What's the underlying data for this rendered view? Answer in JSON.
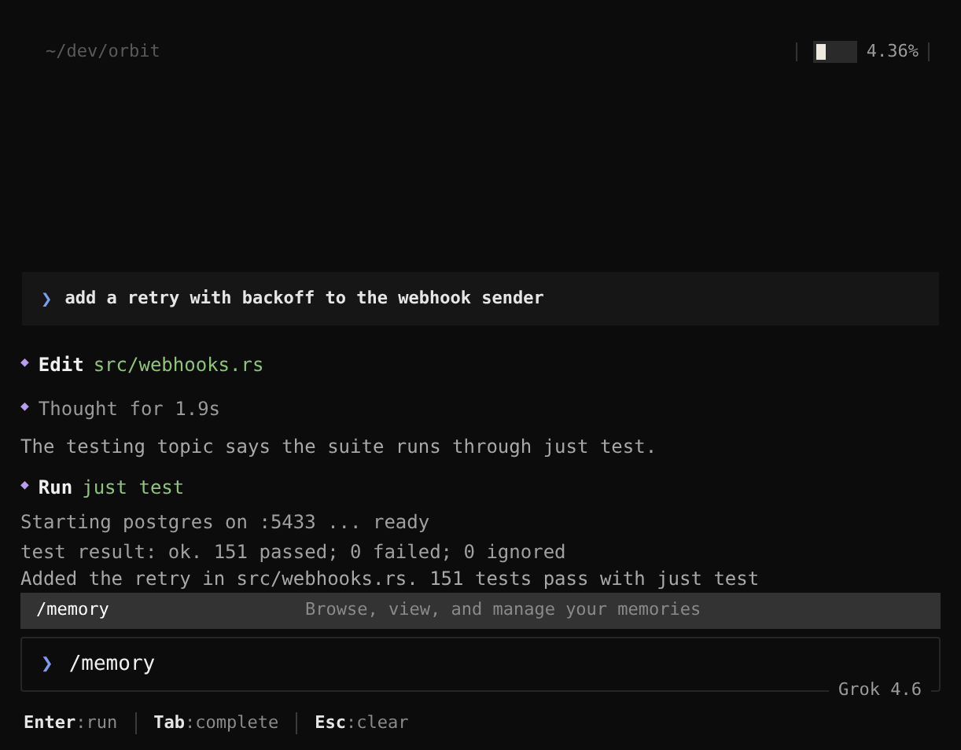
{
  "header": {
    "path": "~/dev/orbit",
    "context": {
      "level": 0.25,
      "reading": "4.36%"
    }
  },
  "prompt": {
    "glyph": "❯",
    "text": "add a retry with backoff to the webhook sender"
  },
  "transcript": [
    {
      "kind": "action",
      "marker": "◆",
      "verb": "Edit",
      "target": "src/webhooks.rs"
    },
    {
      "kind": "thought",
      "marker": "◆",
      "text": "Thought for 1.9s"
    },
    {
      "kind": "text",
      "text": "The testing topic says the suite runs through just test."
    },
    {
      "kind": "action",
      "marker": "◆",
      "verb": "Run",
      "target": "just test"
    },
    {
      "kind": "output",
      "lines": [
        "Starting postgres on :5433 ... ready",
        "test result: ok. 151 passed; 0 failed; 0 ignored"
      ]
    },
    {
      "kind": "text",
      "text": "Added the retry in src/webhooks.rs. 151 tests pass with just test"
    }
  ],
  "suggestions": [
    {
      "command": "/memory",
      "description": "Browse, view, and manage your memories",
      "selected": true
    }
  ],
  "input": {
    "glyph": "❯",
    "value": "/memory",
    "model": "Grok 4.6"
  },
  "shortcuts": [
    {
      "key": "Enter",
      "action": ":run"
    },
    {
      "key": "Tab",
      "action": ":complete"
    },
    {
      "key": "Esc",
      "action": ":clear"
    }
  ]
}
